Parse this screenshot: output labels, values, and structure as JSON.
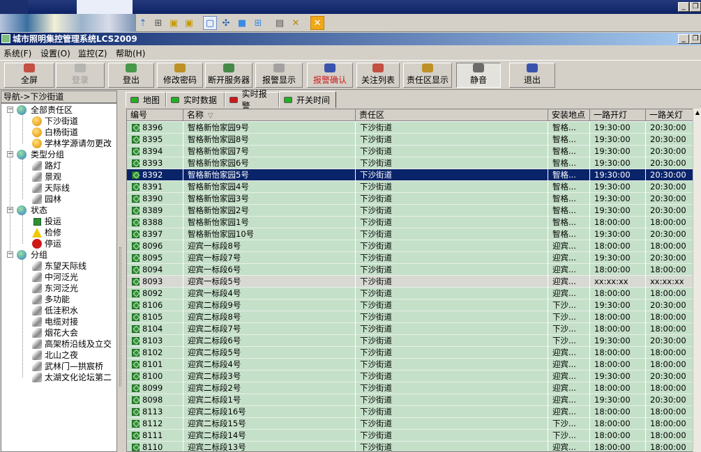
{
  "app_title": "城市照明集控管理系统LCS2009",
  "window_controls": {
    "min": "_",
    "restore": "❐"
  },
  "menus": [
    "系统(F)",
    "设置(O)",
    "监控(Z)",
    "帮助(H)"
  ],
  "toolbar": [
    {
      "label": "全屏",
      "icon": "fullscreen-icon",
      "color": "#c0392b",
      "state": "normal"
    },
    {
      "label": "登录",
      "icon": "login-icon",
      "color": "#9a9a9a",
      "state": "disabled"
    },
    {
      "label": "登出",
      "icon": "logout-icon",
      "color": "#2f8f33",
      "state": "normal"
    },
    {
      "label": "修改密码",
      "icon": "password-icon",
      "color": "#b8860b",
      "state": "normal"
    },
    {
      "label": "断开服务器",
      "icon": "disconnect-server-icon",
      "color": "#2e7d32",
      "state": "normal"
    },
    {
      "label": "报警显示",
      "icon": "alarm-display-icon",
      "color": "#9a9a9a",
      "state": "normal"
    },
    {
      "label": "报警确认",
      "icon": "alarm-confirm-icon",
      "color": "#1f3ea8",
      "state": "alarm"
    },
    {
      "label": "关注列表",
      "icon": "watch-list-icon",
      "color": "#c0392b",
      "state": "normal"
    },
    {
      "label": "责任区显示",
      "icon": "zone-display-icon",
      "color": "#b8860b",
      "state": "normal"
    },
    {
      "label": "静音",
      "icon": "mute-icon",
      "color": "#555555",
      "state": "pressed"
    },
    {
      "label": "退出",
      "icon": "exit-icon",
      "color": "#1f3ea8",
      "state": "normal"
    }
  ],
  "nav_title": "导航->下沙街道",
  "tree": [
    {
      "label": "全部责任区",
      "level": 0,
      "icon": "globe-icon",
      "expander": "−"
    },
    {
      "label": "下沙街道",
      "level": 1,
      "icon": "district-icon"
    },
    {
      "label": "白杨街道",
      "level": 1,
      "icon": "district-icon"
    },
    {
      "label": "学林学源请勿更改",
      "level": 1,
      "icon": "district-icon"
    },
    {
      "label": "类型分组",
      "level": 0,
      "icon": "globe-icon",
      "expander": "−"
    },
    {
      "label": "路灯",
      "level": 1,
      "icon": "lamp-icon"
    },
    {
      "label": "景观",
      "level": 1,
      "icon": "lamp-icon"
    },
    {
      "label": "天际线",
      "level": 1,
      "icon": "lamp-icon"
    },
    {
      "label": "园林",
      "level": 1,
      "icon": "lamp-icon"
    },
    {
      "label": "状态",
      "level": 0,
      "icon": "globe-icon",
      "expander": "−"
    },
    {
      "label": "投运",
      "level": 1,
      "icon": "status-ok-icon"
    },
    {
      "label": "检修",
      "level": 1,
      "icon": "warning-icon"
    },
    {
      "label": "停运",
      "level": 1,
      "icon": "error-icon"
    },
    {
      "label": "分组",
      "level": 0,
      "icon": "globe-icon",
      "expander": "−"
    },
    {
      "label": "东望天际线",
      "level": 1,
      "icon": "lamp-icon"
    },
    {
      "label": "中河泛光",
      "level": 1,
      "icon": "lamp-icon"
    },
    {
      "label": "东河泛光",
      "level": 1,
      "icon": "lamp-icon"
    },
    {
      "label": "多功能",
      "level": 1,
      "icon": "lamp-icon"
    },
    {
      "label": "低洼积水",
      "level": 1,
      "icon": "lamp-icon"
    },
    {
      "label": "电缆对接",
      "level": 1,
      "icon": "lamp-icon"
    },
    {
      "label": "烟花大会",
      "level": 1,
      "icon": "lamp-icon"
    },
    {
      "label": "高架桥沿线及立交",
      "level": 1,
      "icon": "lamp-icon"
    },
    {
      "label": "北山之夜",
      "level": 1,
      "icon": "lamp-icon"
    },
    {
      "label": "武林门—拱宸桥",
      "level": 1,
      "icon": "lamp-icon"
    },
    {
      "label": "太湖文化论坛第二",
      "level": 1,
      "icon": "lamp-icon"
    }
  ],
  "tabs": [
    {
      "label": "地图",
      "color": "#22b022",
      "active": false
    },
    {
      "label": "实时数据",
      "color": "#22b022",
      "active": false
    },
    {
      "label": "实时报警",
      "color": "#d01818",
      "active": false
    },
    {
      "label": "开关时间",
      "color": "#22b022",
      "active": true
    }
  ],
  "grid": {
    "columns": [
      "编号",
      "名称",
      "责任区",
      "安装地点",
      "一路开灯",
      "一路关灯"
    ],
    "sort_indicator": "▽",
    "rows": [
      [
        "8396",
        "智格新怡家园9号",
        "下沙街道",
        "智格...",
        "19:30:00",
        "20:30:00"
      ],
      [
        "8395",
        "智格新怡家园8号",
        "下沙街道",
        "智格...",
        "19:30:00",
        "20:30:00"
      ],
      [
        "8394",
        "智格新怡家园7号",
        "下沙街道",
        "智格...",
        "19:30:00",
        "20:30:00"
      ],
      [
        "8393",
        "智格新怡家园6号",
        "下沙街道",
        "智格...",
        "19:30:00",
        "20:30:00"
      ],
      [
        "8392",
        "智格新怡家园5号",
        "下沙街道",
        "智格...",
        "19:30:00",
        "20:30:00"
      ],
      [
        "8391",
        "智格新怡家园4号",
        "下沙街道",
        "智格...",
        "19:30:00",
        "20:30:00"
      ],
      [
        "8390",
        "智格新怡家园3号",
        "下沙街道",
        "智格...",
        "19:30:00",
        "20:30:00"
      ],
      [
        "8389",
        "智格新怡家园2号",
        "下沙街道",
        "智格...",
        "19:30:00",
        "20:30:00"
      ],
      [
        "8388",
        "智格新怡家园1号",
        "下沙街道",
        "智格...",
        "18:00:00",
        "18:00:00"
      ],
      [
        "8397",
        "智格新怡家园10号",
        "下沙街道",
        "智格...",
        "19:30:00",
        "20:30:00"
      ],
      [
        "8096",
        "迎宾一标段8号",
        "下沙街道",
        "迎宾...",
        "18:00:00",
        "18:00:00"
      ],
      [
        "8095",
        "迎宾一标段7号",
        "下沙街道",
        "迎宾...",
        "19:30:00",
        "20:30:00"
      ],
      [
        "8094",
        "迎宾一标段6号",
        "下沙街道",
        "迎宾...",
        "18:00:00",
        "18:00:00"
      ],
      [
        "8093",
        "迎宾一标段5号",
        "下沙街道",
        "迎宾...",
        "xx:xx:xx",
        "xx:xx:xx"
      ],
      [
        "8092",
        "迎宾一标段4号",
        "下沙街道",
        "迎宾...",
        "18:00:00",
        "18:00:00"
      ],
      [
        "8106",
        "迎宾二标段9号",
        "下沙街道",
        "下沙...",
        "19:30:00",
        "20:30:00"
      ],
      [
        "8105",
        "迎宾二标段8号",
        "下沙街道",
        "下沙...",
        "18:00:00",
        "18:00:00"
      ],
      [
        "8104",
        "迎宾二标段7号",
        "下沙街道",
        "下沙...",
        "18:00:00",
        "18:00:00"
      ],
      [
        "8103",
        "迎宾二标段6号",
        "下沙街道",
        "下沙...",
        "19:30:00",
        "20:30:00"
      ],
      [
        "8102",
        "迎宾二标段5号",
        "下沙街道",
        "迎宾...",
        "18:00:00",
        "18:00:00"
      ],
      [
        "8101",
        "迎宾二标段4号",
        "下沙街道",
        "迎宾...",
        "18:00:00",
        "18:00:00"
      ],
      [
        "8100",
        "迎宾二标段3号",
        "下沙街道",
        "迎宾...",
        "19:30:00",
        "20:30:00"
      ],
      [
        "8099",
        "迎宾二标段2号",
        "下沙街道",
        "迎宾...",
        "18:00:00",
        "18:00:00"
      ],
      [
        "8098",
        "迎宾二标段1号",
        "下沙街道",
        "迎宾...",
        "19:30:00",
        "20:30:00"
      ],
      [
        "8113",
        "迎宾二标段16号",
        "下沙街道",
        "迎宾...",
        "18:00:00",
        "18:00:00"
      ],
      [
        "8112",
        "迎宾二标段15号",
        "下沙街道",
        "下沙...",
        "18:00:00",
        "18:00:00"
      ],
      [
        "8111",
        "迎宾二标段14号",
        "下沙街道",
        "下沙...",
        "18:00:00",
        "18:00:00"
      ],
      [
        "8110",
        "迎宾二标段13号",
        "下沙街道",
        "迎宾...",
        "18:00:00",
        "18:00:00"
      ]
    ],
    "selected_row": 4,
    "highlight_row": 13
  }
}
